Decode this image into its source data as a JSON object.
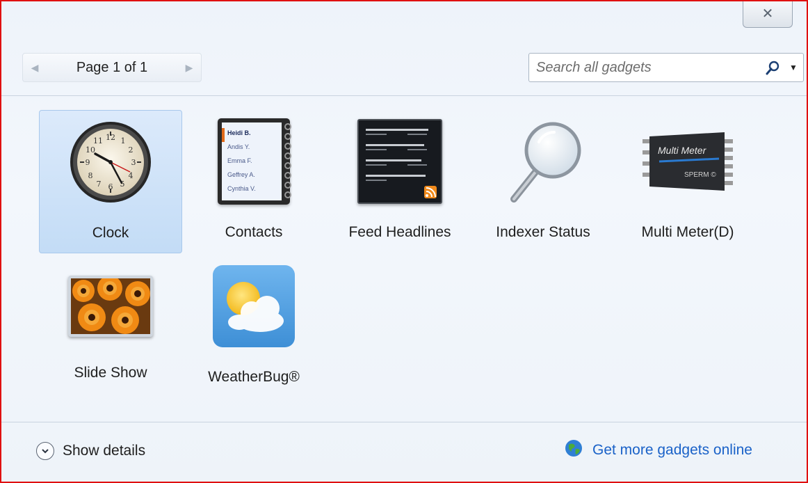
{
  "window": {
    "close_glyph": "✕"
  },
  "pager": {
    "prev_glyph": "◀",
    "text": "Page 1 of 1",
    "next_glyph": "▶"
  },
  "search": {
    "placeholder": "Search all gadgets",
    "value": "",
    "icon": "search-icon",
    "dropdown_glyph": "▼"
  },
  "gadgets": [
    {
      "label": "Clock",
      "icon": "clock-icon",
      "selected": true
    },
    {
      "label": "Contacts",
      "icon": "contacts-icon",
      "selected": false
    },
    {
      "label": "Feed Headlines",
      "icon": "rss-feed-icon",
      "selected": false
    },
    {
      "label": "Indexer Status",
      "icon": "magnifier-icon",
      "selected": false
    },
    {
      "label": "Multi Meter(D)",
      "icon": "chip-meter-icon",
      "selected": false
    },
    {
      "label": "Slide Show",
      "icon": "photo-icon",
      "selected": false
    },
    {
      "label": "WeatherBug®",
      "icon": "weather-icon",
      "selected": false
    }
  ],
  "contacts_card": {
    "names": [
      "Heidi B.",
      "Andis Y.",
      "Emma F.",
      "Geffrey A.",
      "Cynthia V."
    ]
  },
  "multimeter_card": {
    "title": "Multi Meter",
    "subtitle": "SPERM ©"
  },
  "footer": {
    "details_label": "Show details",
    "online_label": "Get more gadgets online"
  },
  "colors": {
    "accent": "#1a62c8",
    "selection": "#c9dff7",
    "frame": "#e01010"
  }
}
